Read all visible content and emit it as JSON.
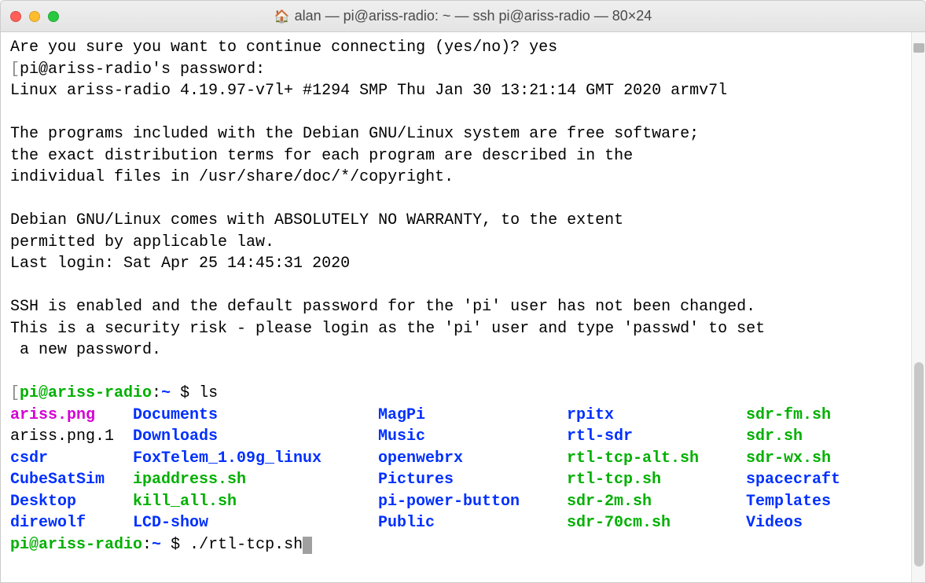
{
  "window": {
    "title": "alan — pi@ariss-radio: ~ — ssh pi@ariss-radio — 80×24"
  },
  "motd": {
    "confirm": "Are you sure you want to continue connecting (yes/no)? yes",
    "pwprompt": "pi@ariss-radio's password:",
    "uname": "Linux ariss-radio 4.19.97-v7l+ #1294 SMP Thu Jan 30 13:21:14 GMT 2020 armv7l",
    "l1": "The programs included with the Debian GNU/Linux system are free software;",
    "l2": "the exact distribution terms for each program are described in the",
    "l3": "individual files in /usr/share/doc/*/copyright.",
    "l4": "Debian GNU/Linux comes with ABSOLUTELY NO WARRANTY, to the extent",
    "l5": "permitted by applicable law.",
    "last": "Last login: Sat Apr 25 14:45:31 2020",
    "s1": "SSH is enabled and the default password for the 'pi' user has not been changed.",
    "s2": "This is a security risk - please login as the 'pi' user and type 'passwd' to set",
    "s3": " a new password."
  },
  "prompt": {
    "user": "pi@ariss-radio",
    "sep": ":",
    "path": "~",
    "dollar": " $ ",
    "cmd_ls": "ls",
    "cmd_run": "./rtl-tcp.sh"
  },
  "ls": {
    "rows": [
      [
        {
          "t": "ariss.png",
          "c": "magenta"
        },
        {
          "t": "Documents",
          "c": "blue"
        },
        {
          "t": "MagPi",
          "c": "blue"
        },
        {
          "t": "rpitx",
          "c": "blue"
        },
        {
          "t": "sdr-fm.sh",
          "c": "green"
        }
      ],
      [
        {
          "t": "ariss.png.1",
          "c": "plain"
        },
        {
          "t": "Downloads",
          "c": "blue"
        },
        {
          "t": "Music",
          "c": "blue"
        },
        {
          "t": "rtl-sdr",
          "c": "blue"
        },
        {
          "t": "sdr.sh",
          "c": "green"
        }
      ],
      [
        {
          "t": "csdr",
          "c": "blue"
        },
        {
          "t": "FoxTelem_1.09g_linux",
          "c": "blue"
        },
        {
          "t": "openwebrx",
          "c": "blue"
        },
        {
          "t": "rtl-tcp-alt.sh",
          "c": "green"
        },
        {
          "t": "sdr-wx.sh",
          "c": "green"
        }
      ],
      [
        {
          "t": "CubeSatSim",
          "c": "blue"
        },
        {
          "t": "ipaddress.sh",
          "c": "green"
        },
        {
          "t": "Pictures",
          "c": "blue"
        },
        {
          "t": "rtl-tcp.sh",
          "c": "green"
        },
        {
          "t": "spacecraft",
          "c": "blue"
        }
      ],
      [
        {
          "t": "Desktop",
          "c": "blue"
        },
        {
          "t": "kill_all.sh",
          "c": "green"
        },
        {
          "t": "pi-power-button",
          "c": "blue"
        },
        {
          "t": "sdr-2m.sh",
          "c": "green"
        },
        {
          "t": "Templates",
          "c": "blue"
        }
      ],
      [
        {
          "t": "direwolf",
          "c": "blue"
        },
        {
          "t": "LCD-show",
          "c": "blue"
        },
        {
          "t": "Public",
          "c": "blue"
        },
        {
          "t": "sdr-70cm.sh",
          "c": "green"
        },
        {
          "t": "Videos",
          "c": "blue"
        }
      ]
    ]
  }
}
